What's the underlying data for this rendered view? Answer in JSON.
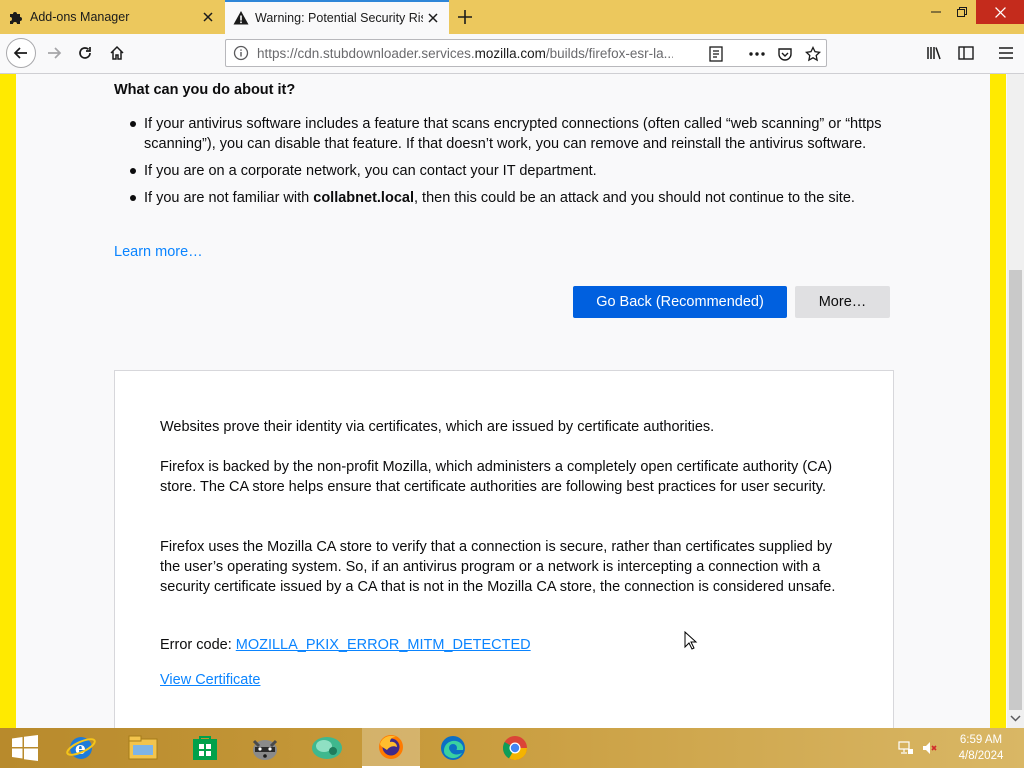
{
  "tabs": [
    {
      "title": "Add-ons Manager",
      "icon": "puzzle-piece-icon",
      "active": false
    },
    {
      "title": "Warning: Potential Security Risk Ahead",
      "icon": "warning-triangle-icon",
      "active": true
    }
  ],
  "navbar": {
    "url_prefix": "https://cdn.stubdownloader.services.",
    "url_domain": "mozilla.com",
    "url_suffix": "/builds/firefox-esr-la..."
  },
  "content": {
    "heading": "What can you do about it?",
    "bullets": {
      "b1": "If your antivirus software includes a feature that scans encrypted connections (often called “web scanning” or “https scanning”), you can disable that feature. If that doesn’t work, you can remove and reinstall the antivirus software.",
      "b2": "If you are on a corporate network, you can contact your IT department.",
      "b3_pre": "If you are not familiar with ",
      "b3_host": "collabnet.local",
      "b3_post": ", then this could be an attack and you should not continue to the site."
    },
    "learn_more": "Learn more…",
    "go_back_label": "Go Back (Recommended)",
    "more_label": "More…",
    "advanced": {
      "p1": "Websites prove their identity via certificates, which are issued by certificate authorities.",
      "p2": "Firefox is backed by the non-profit Mozilla, which administers a completely open certificate authority (CA) store. The CA store helps ensure that certificate authorities are following best practices for user security.",
      "p3": "Firefox uses the Mozilla CA store to verify that a connection is secure, rather than certificates supplied by the user’s operating system. So, if an antivirus program or a network is intercepting a connection with a security certificate issued by a CA that is not in the Mozilla CA store, the connection is considered unsafe.",
      "error_code_label": "Error code: ",
      "error_code": "MOZILLA_PKIX_ERROR_MITM_DETECTED",
      "view_certificate": "View Certificate"
    }
  },
  "taskbar": {
    "items": [
      "start-button",
      "internet-explorer-icon",
      "file-explorer-icon",
      "store-icon",
      "raccoon-app-icon",
      "green-app-icon",
      "firefox-icon",
      "edge-icon",
      "chrome-icon"
    ],
    "active_item": "firefox-icon",
    "time": "6:59 AM",
    "date": "4/8/2024"
  },
  "colors": {
    "titlebar": "#ecc85d",
    "accent_blue": "#0060df",
    "link_blue": "#0a84ff",
    "side_yellow": "#ffea00"
  }
}
